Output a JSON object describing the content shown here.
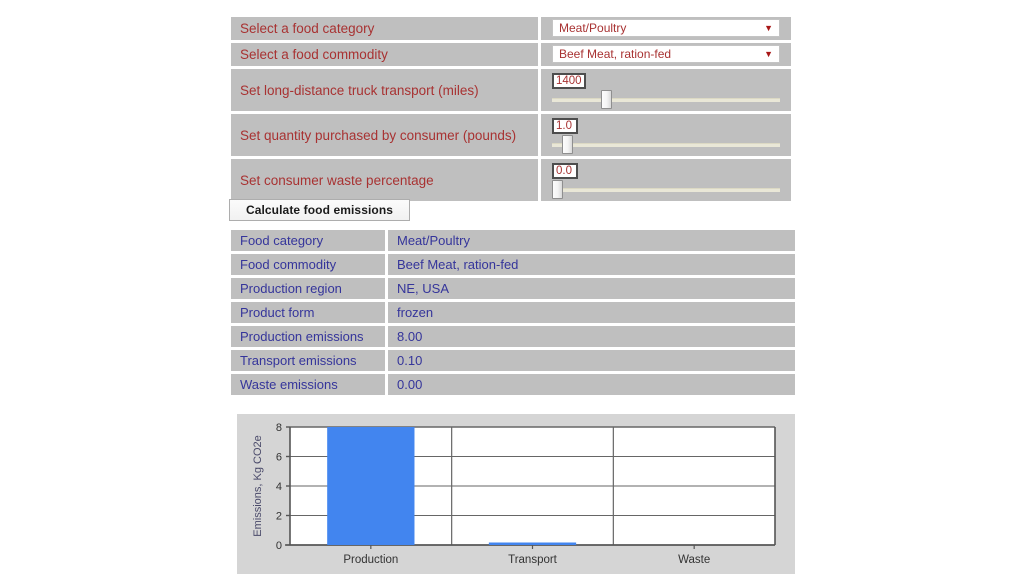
{
  "controls": [
    {
      "id": "food-category",
      "label": "Select a food category",
      "type": "select",
      "value": "Meat/Poultry",
      "arrow": "chevron-down-icon"
    },
    {
      "id": "food-commodity",
      "label": "Select a food commodity",
      "type": "select",
      "value": "Beef Meat, ration-fed",
      "arrow": "chevron-down-icon"
    },
    {
      "id": "truck-transport",
      "label": "Set long-distance truck transport (miles)",
      "type": "slider",
      "value": "1400",
      "thumb_percent": 22.5
    },
    {
      "id": "quantity-purchased",
      "label": "Set quantity purchased by consumer (pounds)",
      "type": "slider",
      "value": "1.0",
      "thumb_percent": 4.5
    },
    {
      "id": "waste-percentage",
      "label": "Set consumer waste percentage",
      "type": "slider",
      "value": "0.0",
      "thumb_percent": 0.0
    }
  ],
  "actions": {
    "calculate_label": "Calculate food emissions"
  },
  "results": [
    {
      "key": "Food category",
      "value": "Meat/Poultry"
    },
    {
      "key": "Food commodity",
      "value": "Beef Meat, ration-fed"
    },
    {
      "key": "Production region",
      "value": "NE, USA"
    },
    {
      "key": "Product form",
      "value": "frozen"
    },
    {
      "key": "Production emissions",
      "value": "8.00"
    },
    {
      "key": "Transport emissions",
      "value": "0.10"
    },
    {
      "key": "Waste emissions",
      "value": "0.00"
    }
  ],
  "chart_data": {
    "type": "bar",
    "title": "",
    "xlabel": "",
    "ylabel": "Emissions, Kg CO2e",
    "categories": [
      "Production",
      "Transport",
      "Waste"
    ],
    "values": [
      8.0,
      0.1,
      0.0
    ],
    "ylim": [
      0,
      8
    ],
    "yticks": [
      0,
      2,
      4,
      6,
      8
    ],
    "ytick_labels": [
      "0",
      "2",
      "4",
      "6",
      "8"
    ],
    "grid": true,
    "legend": false,
    "bar_color": "#4285ef",
    "plot_bg": "#ffffff",
    "panel_bg": "#d5d5d5",
    "axis_color": "#555555",
    "grid_color": "#666666"
  },
  "colors": {
    "panel_gray": "#bfbfbf",
    "label_red": "#a83232",
    "result_blue": "#35359b",
    "slider_track": "#e9e7d7",
    "bar_blue": "#4285ef"
  }
}
